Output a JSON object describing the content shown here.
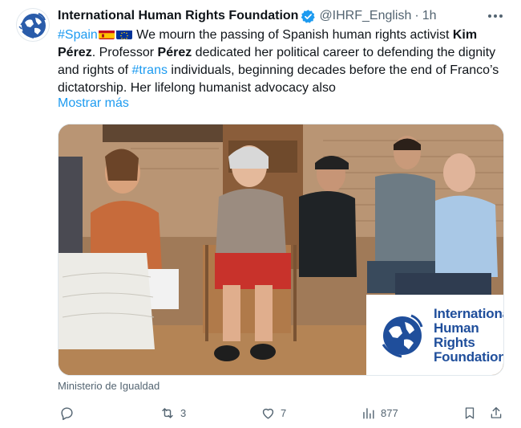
{
  "tweet": {
    "author": {
      "display_name": "International Human Rights Foundation",
      "handle": "@IHRF_English",
      "time": "1h",
      "verified": true
    },
    "text": {
      "hashtag_spain": "#Spain",
      "flags": [
        "spain-flag",
        "eu-flag"
      ],
      "part1": " We mourn the passing of Spanish human rights activist ",
      "name_bold": "Kim Pérez",
      "part2": ". Professor ",
      "name_bold_2": "Pérez",
      "part3": " dedicated her political career to defending the dignity and rights of ",
      "hashtag_trans": "#trans",
      "part4": " individuals, beginning decades before the end of Franco’s dictatorship. Her lifelong humanist advocacy also"
    },
    "show_more": "Mostrar más",
    "media": {
      "logo_text": [
        "International",
        "Human Rights",
        "Foundation"
      ]
    },
    "media_caption": "Ministerio de Igualdad",
    "actions": {
      "reply_count": "",
      "retweet_count": "3",
      "like_count": "7",
      "views_count": "877"
    }
  },
  "colors": {
    "link": "#1d9bf0",
    "muted": "#536471",
    "text": "#0f1419",
    "logo_blue": "#1f4e9b"
  }
}
